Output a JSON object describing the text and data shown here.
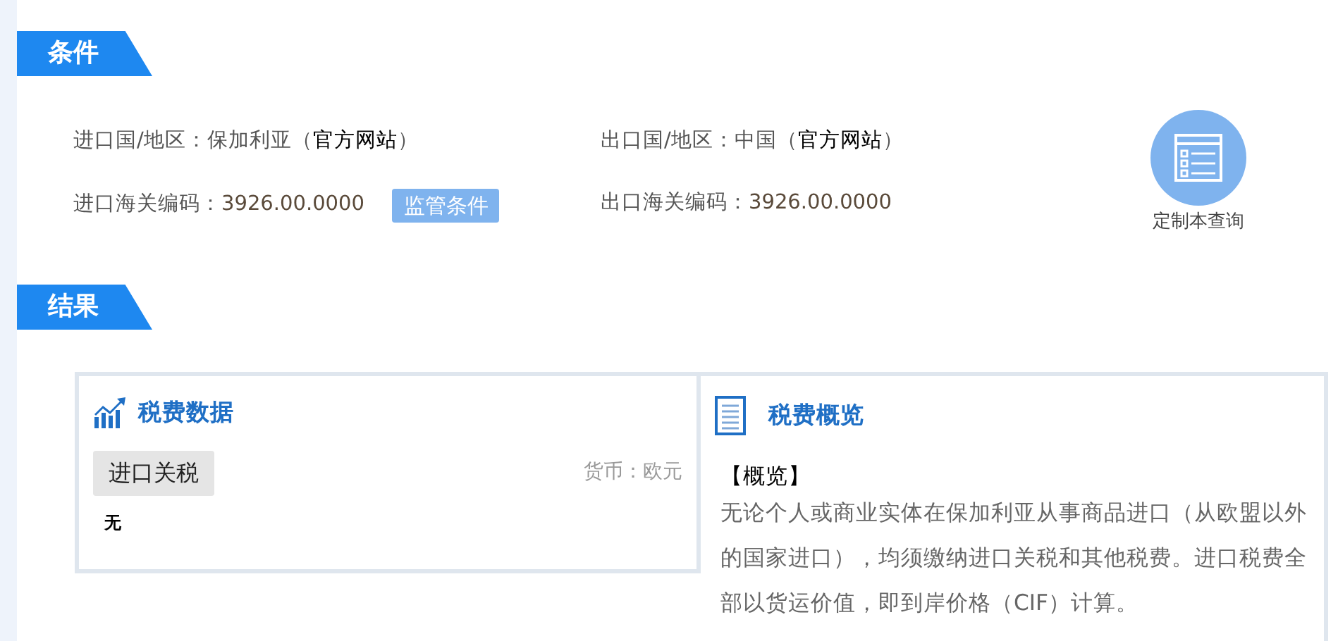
{
  "conditions": {
    "title": "条件",
    "rows": [
      [
        {
          "prefix": "进口国/地区：保加利亚（",
          "link": "官方网站",
          "suffix": "）"
        },
        {
          "prefix": "出口国/地区：中国（",
          "link": "官方网站",
          "suffix": "）"
        }
      ],
      [
        {
          "label": "进口海关编码：",
          "code": "3926.00.0000",
          "button": "监管条件"
        },
        {
          "label": "出口海关编码：",
          "code": "3926.00.0000"
        }
      ]
    ],
    "custom_query": "定制本查询"
  },
  "results": {
    "title": "结果",
    "tax_data": {
      "title": "税费数据",
      "tag": "进口关税",
      "currency": "货币：欧元",
      "value": "无"
    },
    "overview": {
      "title": "税费概览",
      "heading": "【概览】",
      "text": "无论个人或商业实体在保加利亚从事商品进口（从欧盟以外的国家进口），均须缴纳进口关税和其他税费。进口税费全部以货运价值，即到岸价格（CIF）计算。"
    }
  }
}
